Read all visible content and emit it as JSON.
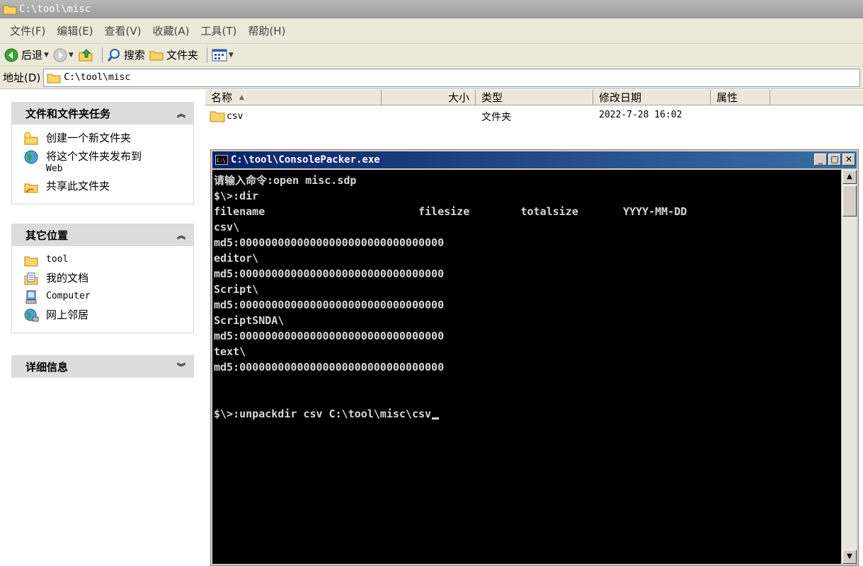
{
  "window": {
    "title": "C:\\tool\\misc"
  },
  "menu": [
    "文件(F)",
    "编辑(E)",
    "查看(V)",
    "收藏(A)",
    "工具(T)",
    "帮助(H)"
  ],
  "toolbar": {
    "back_label": "后退",
    "search_label": "搜索",
    "folders_label": "文件夹"
  },
  "address": {
    "label": "地址(D)",
    "value": "C:\\tool\\misc"
  },
  "tasks": {
    "header": "文件和文件夹任务",
    "items": [
      {
        "label": "创建一个新文件夹",
        "icon": "new-folder-icon"
      },
      {
        "label": "将这个文件夹发布到",
        "label2": "Web",
        "icon": "publish-web-icon"
      },
      {
        "label": "共享此文件夹",
        "icon": "share-folder-icon"
      }
    ]
  },
  "places": {
    "header": "其它位置",
    "items": [
      {
        "label": "tool",
        "icon": "folder-icon"
      },
      {
        "label": "我的文档",
        "icon": "my-documents-icon"
      },
      {
        "label": "Computer",
        "icon": "computer-icon"
      },
      {
        "label": "网上邻居",
        "icon": "network-icon"
      }
    ]
  },
  "details": {
    "header": "详细信息"
  },
  "filelist": {
    "columns": {
      "name": "名称",
      "size": "大小",
      "type": "类型",
      "modified": "修改日期",
      "attributes": "属性"
    },
    "rows": [
      {
        "name": "csv",
        "size": "",
        "type": "文件夹",
        "modified": "2022-7-28 16:02",
        "attributes": ""
      }
    ]
  },
  "console": {
    "title": "C:\\tool\\ConsolePacker.exe",
    "lines": [
      "请输入命令:open misc.sdp",
      "$\\>:dir",
      "filename                        filesize        totalsize       YYYY-MM-DD",
      "csv\\",
      "md5:00000000000000000000000000000000",
      "editor\\",
      "md5:00000000000000000000000000000000",
      "Script\\",
      "md5:00000000000000000000000000000000",
      "ScriptSNDA\\",
      "md5:00000000000000000000000000000000",
      "text\\",
      "md5:00000000000000000000000000000000",
      "",
      "",
      "$\\>:unpackdir csv C:\\tool\\misc\\csv"
    ]
  },
  "colors": {
    "console_bg": "#000000",
    "console_text": "#d8d8d8",
    "console_title_start": "#0a246a",
    "console_title_end": "#3a6ea5",
    "task_header_bg": "#dcdcdc"
  }
}
